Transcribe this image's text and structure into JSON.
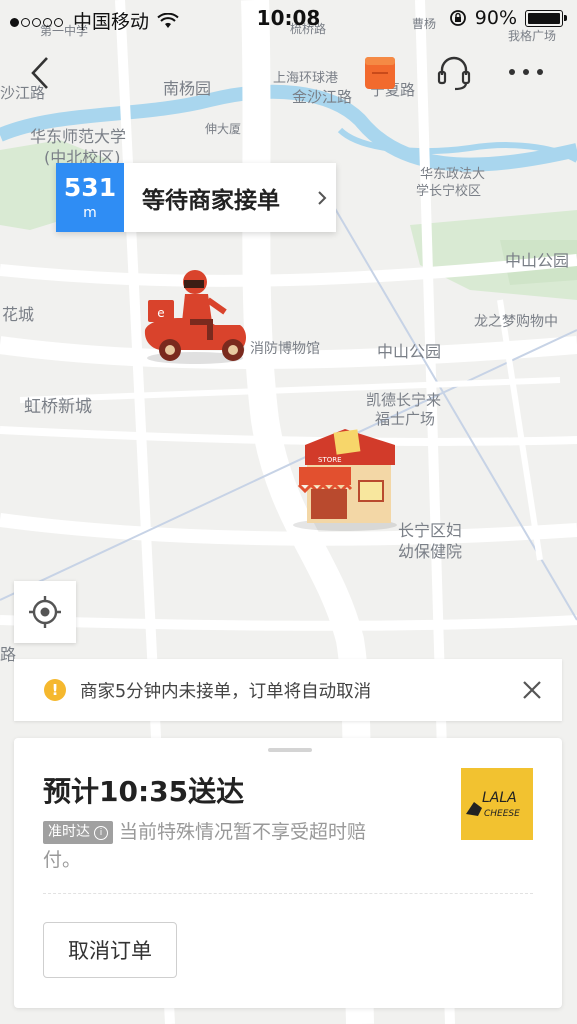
{
  "status_bar": {
    "carrier": "中国移动",
    "time": "10:08",
    "battery": "90%"
  },
  "header": {
    "back_icon": "back-chevron-icon",
    "bag_icon": "ele-bag-icon",
    "support_icon": "headset-icon",
    "more_icon": "more-dots-icon"
  },
  "map": {
    "labels": {
      "nanyang": "南杨园",
      "jinshajiang_top": "金沙江路",
      "huanqiu": "上海环球港",
      "ningxia": "宁夏路",
      "shajiang": "沙江路",
      "ecnu1": "华东师范大学",
      "ecnu2": "(中北校区)",
      "shendaqiao": "伸大厦",
      "ecupl1": "华东政法大",
      "ecupl2": "学长宁校区",
      "zhongshan_park_r": "中山公园",
      "longzhimeng": "龙之梦购物中",
      "huacheng": "花城",
      "fire_museum": "消防博物馆",
      "zhongshan_park": "中山公园",
      "hongqiao": "虹桥新城",
      "kaide1": "凯德长宁来",
      "kaide2": "福士广场",
      "hospital1": "长宁区妇",
      "hospital2": "幼保健院",
      "road_bottom": "路",
      "top_left": "第一中学",
      "top_mid": "梳桥路",
      "top_right": "曹杨",
      "top_right2": "我格广场"
    },
    "rider_icon": "delivery-rider-icon",
    "store_icon": "store-icon",
    "store_sign": "STORE"
  },
  "distance_card": {
    "value": "531",
    "unit": "m",
    "status": "等待商家接单",
    "chevron_icon": "chevron-right-icon"
  },
  "locate_button": {
    "icon": "locate-target-icon"
  },
  "notice": {
    "icon": "warning-icon",
    "text": "商家5分钟内未接单，订单将自动取消",
    "close_icon": "close-icon"
  },
  "order_sheet": {
    "eta": "预计10:35送达",
    "ontime_badge": "准时达",
    "ontime_note": "当前特殊情况暂不享受超时赔付。",
    "shop_logo_line1": "LALA",
    "shop_logo_line2": "CHEESE",
    "cancel_label": "取消订单"
  },
  "colors": {
    "accent_blue": "#2f8df4",
    "warning_yellow": "#f5b82e",
    "brand_orange": "#f26a2e",
    "logo_yellow": "#f2c230"
  }
}
